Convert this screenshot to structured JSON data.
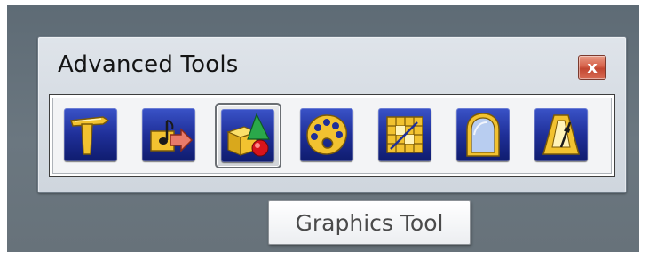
{
  "window": {
    "title": "Advanced Tools",
    "close_label": "x"
  },
  "toolbar": {
    "tools": [
      {
        "icon": "hammer-icon"
      },
      {
        "icon": "import-music-icon"
      },
      {
        "icon": "graphics-icon",
        "active": true
      },
      {
        "icon": "palette-icon"
      },
      {
        "icon": "grid-edit-icon"
      },
      {
        "icon": "arch-frame-icon"
      },
      {
        "icon": "metronome-icon"
      }
    ]
  },
  "tooltip": {
    "text": "Graphics Tool"
  },
  "colors": {
    "icon_blue": "#1f2f98",
    "icon_gold": "#f2c230",
    "close_red": "#c24731",
    "palette_bg": "#d6dce3",
    "desktop_bg": "#67727a"
  }
}
